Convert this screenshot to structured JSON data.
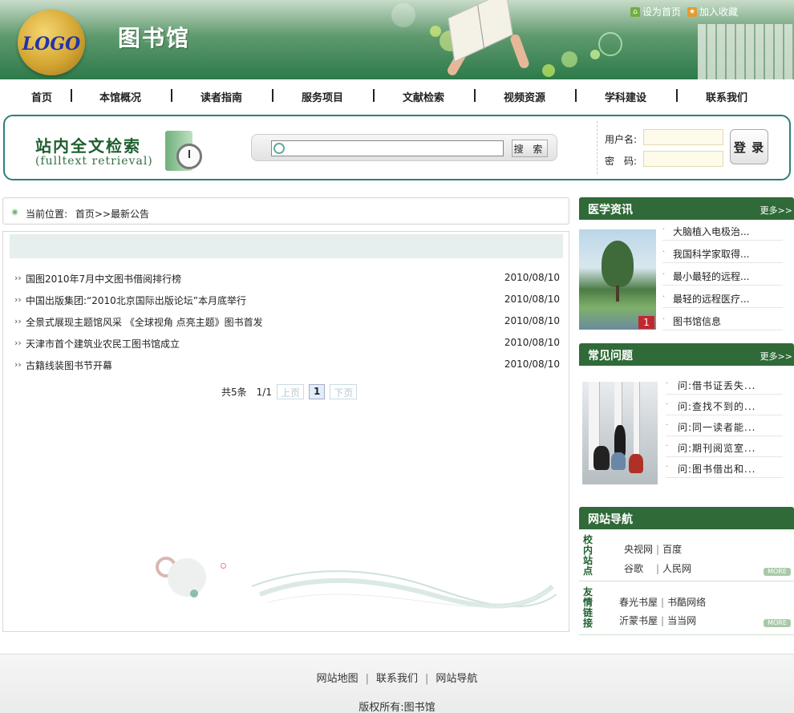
{
  "header": {
    "logo_text": "LOGO",
    "site_title": "图书馆",
    "top_links": [
      {
        "label": "设为首页",
        "icon": "home-icon"
      },
      {
        "label": "加入收藏",
        "icon": "favorite-icon"
      }
    ]
  },
  "nav": {
    "items": [
      "首页",
      "本馆概况",
      "读者指南",
      "服务项目",
      "文献检索",
      "视频资源",
      "学科建设",
      "联系我们"
    ]
  },
  "search": {
    "title": "站内全文检索",
    "subtitle": "(fulltext retrieval)",
    "input_value": "",
    "button_label": "搜 索"
  },
  "login": {
    "username_label": "用户名:",
    "password_label": "密　码:",
    "username_value": "",
    "password_value": "",
    "button_label": "登 录"
  },
  "breadcrumb": {
    "prefix": "当前位置:",
    "path": "首页>>最新公告"
  },
  "news": [
    {
      "title": "国图2010年7月中文图书借阅排行榜",
      "date": "2010/08/10"
    },
    {
      "title": "中国出版集团:“2010北京国际出版论坛”本月底举行",
      "date": "2010/08/10"
    },
    {
      "title": "全景式展现主题馆风采 《全球视角 点亮主题》图书首发",
      "date": "2010/08/10"
    },
    {
      "title": "天津市首个建筑业农民工图书馆成立",
      "date": "2010/08/10"
    },
    {
      "title": "古籍线装图书节开幕",
      "date": "2010/08/10"
    }
  ],
  "pager": {
    "total": "共5条",
    "page": "1/1",
    "prev": "上页",
    "current": "1",
    "next": "下页"
  },
  "medical": {
    "title": "医学资讯",
    "more": "更多>>",
    "badge": "1",
    "items": [
      "大脑植入电极治...",
      "我国科学家取得...",
      "最小最轻的远程...",
      "最轻的远程医疗...",
      "图书馆信息"
    ]
  },
  "faq": {
    "title": "常见问题",
    "more": "更多>>",
    "items": [
      "问:借书证丢失...",
      "问:查找不到的...",
      "问:同一读者能...",
      "问:期刊阅览室...",
      "问:图书借出和..."
    ]
  },
  "site_nav": {
    "title": "网站导航",
    "campus_label": "校内站点",
    "campus_links": [
      [
        "央视网",
        "百度"
      ],
      [
        "谷歌",
        "人民网"
      ]
    ],
    "friend_label": "友情链接",
    "friend_links": [
      [
        "春光书屋",
        "书酷网络"
      ],
      [
        "沂蒙书屋",
        "当当网"
      ]
    ],
    "more": "MORE"
  },
  "footer": {
    "links": [
      "网站地图",
      "联系我们",
      "网站导航"
    ],
    "copyright": "版权所有:图书馆"
  }
}
